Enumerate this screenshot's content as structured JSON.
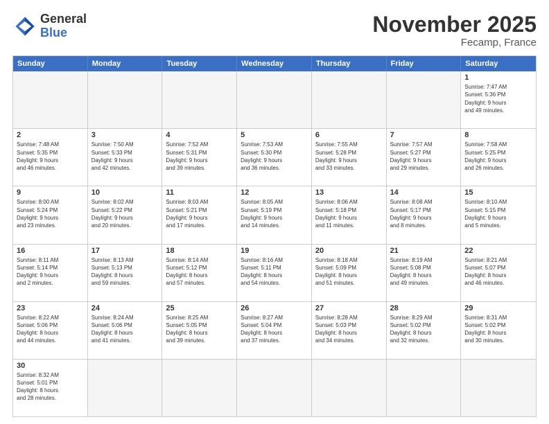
{
  "header": {
    "logo_general": "General",
    "logo_blue": "Blue",
    "title": "November 2025",
    "subtitle": "Fecamp, France"
  },
  "weekdays": [
    "Sunday",
    "Monday",
    "Tuesday",
    "Wednesday",
    "Thursday",
    "Friday",
    "Saturday"
  ],
  "weeks": [
    [
      {
        "day": "",
        "empty": true
      },
      {
        "day": "",
        "empty": true
      },
      {
        "day": "",
        "empty": true
      },
      {
        "day": "",
        "empty": true
      },
      {
        "day": "",
        "empty": true
      },
      {
        "day": "",
        "empty": true
      },
      {
        "day": "1",
        "info": "Sunrise: 7:47 AM\nSunset: 5:36 PM\nDaylight: 9 hours\nand 49 minutes."
      }
    ],
    [
      {
        "day": "2",
        "info": "Sunrise: 7:48 AM\nSunset: 5:35 PM\nDaylight: 9 hours\nand 46 minutes."
      },
      {
        "day": "3",
        "info": "Sunrise: 7:50 AM\nSunset: 5:33 PM\nDaylight: 9 hours\nand 42 minutes."
      },
      {
        "day": "4",
        "info": "Sunrise: 7:52 AM\nSunset: 5:31 PM\nDaylight: 9 hours\nand 39 minutes."
      },
      {
        "day": "5",
        "info": "Sunrise: 7:53 AM\nSunset: 5:30 PM\nDaylight: 9 hours\nand 36 minutes."
      },
      {
        "day": "6",
        "info": "Sunrise: 7:55 AM\nSunset: 5:28 PM\nDaylight: 9 hours\nand 33 minutes."
      },
      {
        "day": "7",
        "info": "Sunrise: 7:57 AM\nSunset: 5:27 PM\nDaylight: 9 hours\nand 29 minutes."
      },
      {
        "day": "8",
        "info": "Sunrise: 7:58 AM\nSunset: 5:25 PM\nDaylight: 9 hours\nand 26 minutes."
      }
    ],
    [
      {
        "day": "9",
        "info": "Sunrise: 8:00 AM\nSunset: 5:24 PM\nDaylight: 9 hours\nand 23 minutes."
      },
      {
        "day": "10",
        "info": "Sunrise: 8:02 AM\nSunset: 5:22 PM\nDaylight: 9 hours\nand 20 minutes."
      },
      {
        "day": "11",
        "info": "Sunrise: 8:03 AM\nSunset: 5:21 PM\nDaylight: 9 hours\nand 17 minutes."
      },
      {
        "day": "12",
        "info": "Sunrise: 8:05 AM\nSunset: 5:19 PM\nDaylight: 9 hours\nand 14 minutes."
      },
      {
        "day": "13",
        "info": "Sunrise: 8:06 AM\nSunset: 5:18 PM\nDaylight: 9 hours\nand 11 minutes."
      },
      {
        "day": "14",
        "info": "Sunrise: 8:08 AM\nSunset: 5:17 PM\nDaylight: 9 hours\nand 8 minutes."
      },
      {
        "day": "15",
        "info": "Sunrise: 8:10 AM\nSunset: 5:15 PM\nDaylight: 9 hours\nand 5 minutes."
      }
    ],
    [
      {
        "day": "16",
        "info": "Sunrise: 8:11 AM\nSunset: 5:14 PM\nDaylight: 9 hours\nand 2 minutes."
      },
      {
        "day": "17",
        "info": "Sunrise: 8:13 AM\nSunset: 5:13 PM\nDaylight: 8 hours\nand 59 minutes."
      },
      {
        "day": "18",
        "info": "Sunrise: 8:14 AM\nSunset: 5:12 PM\nDaylight: 8 hours\nand 57 minutes."
      },
      {
        "day": "19",
        "info": "Sunrise: 8:16 AM\nSunset: 5:11 PM\nDaylight: 8 hours\nand 54 minutes."
      },
      {
        "day": "20",
        "info": "Sunrise: 8:18 AM\nSunset: 5:09 PM\nDaylight: 8 hours\nand 51 minutes."
      },
      {
        "day": "21",
        "info": "Sunrise: 8:19 AM\nSunset: 5:08 PM\nDaylight: 8 hours\nand 49 minutes."
      },
      {
        "day": "22",
        "info": "Sunrise: 8:21 AM\nSunset: 5:07 PM\nDaylight: 8 hours\nand 46 minutes."
      }
    ],
    [
      {
        "day": "23",
        "info": "Sunrise: 8:22 AM\nSunset: 5:06 PM\nDaylight: 8 hours\nand 44 minutes."
      },
      {
        "day": "24",
        "info": "Sunrise: 8:24 AM\nSunset: 5:06 PM\nDaylight: 8 hours\nand 41 minutes."
      },
      {
        "day": "25",
        "info": "Sunrise: 8:25 AM\nSunset: 5:05 PM\nDaylight: 8 hours\nand 39 minutes."
      },
      {
        "day": "26",
        "info": "Sunrise: 8:27 AM\nSunset: 5:04 PM\nDaylight: 8 hours\nand 37 minutes."
      },
      {
        "day": "27",
        "info": "Sunrise: 8:28 AM\nSunset: 5:03 PM\nDaylight: 8 hours\nand 34 minutes."
      },
      {
        "day": "28",
        "info": "Sunrise: 8:29 AM\nSunset: 5:02 PM\nDaylight: 8 hours\nand 32 minutes."
      },
      {
        "day": "29",
        "info": "Sunrise: 8:31 AM\nSunset: 5:02 PM\nDaylight: 8 hours\nand 30 minutes."
      }
    ],
    [
      {
        "day": "30",
        "info": "Sunrise: 8:32 AM\nSunset: 5:01 PM\nDaylight: 8 hours\nand 28 minutes."
      },
      {
        "day": "",
        "empty": true
      },
      {
        "day": "",
        "empty": true
      },
      {
        "day": "",
        "empty": true
      },
      {
        "day": "",
        "empty": true
      },
      {
        "day": "",
        "empty": true
      },
      {
        "day": "",
        "empty": true
      }
    ]
  ]
}
